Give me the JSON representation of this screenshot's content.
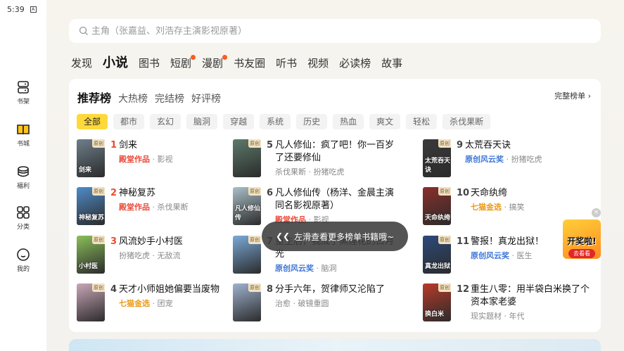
{
  "status": {
    "time": "5:39"
  },
  "sidebar": {
    "items": [
      {
        "label": "书架",
        "icon": "bookshelf-icon"
      },
      {
        "label": "书城",
        "icon": "book-open-icon",
        "active": true
      },
      {
        "label": "福利",
        "icon": "coin-stack-icon"
      },
      {
        "label": "分类",
        "icon": "grid-icon"
      },
      {
        "label": "我的",
        "icon": "smile-icon"
      }
    ]
  },
  "search": {
    "placeholder": "主角（张嘉益、刘浩存主演影视原著）"
  },
  "categories": [
    {
      "label": "发现"
    },
    {
      "label": "小说",
      "active": true
    },
    {
      "label": "图书"
    },
    {
      "label": "短剧",
      "dot": true
    },
    {
      "label": "漫剧",
      "dot": true
    },
    {
      "label": "书友圈"
    },
    {
      "label": "听书"
    },
    {
      "label": "视频"
    },
    {
      "label": "必读榜"
    },
    {
      "label": "故事"
    }
  ],
  "ranking": {
    "tabs": [
      "推荐榜",
      "大热榜",
      "完结榜",
      "好评榜"
    ],
    "full_list": "完整榜单 ›",
    "filters": [
      "全部",
      "都市",
      "玄幻",
      "脑洞",
      "穿越",
      "系统",
      "历史",
      "热血",
      "爽文",
      "轻松",
      "杀伐果断"
    ],
    "books": [
      {
        "rank": "1",
        "title": "剑来",
        "tag": "殿堂作品",
        "tag_color": "red",
        "meta": " · 影视",
        "cover_text": "剑来",
        "cover_color": "#6e7f8a"
      },
      {
        "rank": "2",
        "title": "神秘复苏",
        "tag": "殿堂作品",
        "tag_color": "red",
        "meta": " · 杀伐果断",
        "cover_text": "神秘复苏",
        "cover_color": "#4f8bc9"
      },
      {
        "rank": "3",
        "title": "风流妙手小村医",
        "tag": "",
        "tag_color": "",
        "meta": "扮猪吃虎 · 无敌流",
        "cover_text": "小村医",
        "cover_color": "#8bbf5a"
      },
      {
        "rank": "4",
        "title": "天才小师姐她偏要当废物",
        "tag": "七猫金选",
        "tag_color": "orange",
        "meta": " · 团宠",
        "cover_text": "",
        "cover_color": "#c9a7b8"
      },
      {
        "rank": "5",
        "title": "凡人修仙：疯了吧！你一百岁了还要修仙",
        "tag": "",
        "tag_color": "",
        "meta": "杀伐果断 · 扮猪吃虎",
        "cover_text": "",
        "cover_color": "#5d7a6a"
      },
      {
        "rank": "6",
        "title": "凡人修仙传（杨洋、金晨主演同名影视原著）",
        "tag": "殿堂作品",
        "tag_color": "red",
        "meta": " · 影视",
        "cover_text": "凡人修仙传",
        "cover_color": "#a9c0c8"
      },
      {
        "rank": "7",
        "title": "重生后，我成了黑莲花的白月光",
        "tag": "原创风云奖",
        "tag_color": "blue",
        "meta": " · 脑洞",
        "cover_text": "",
        "cover_color": "#7aa9d8"
      },
      {
        "rank": "8",
        "title": "分手六年，贺律师又沦陷了",
        "tag": "",
        "tag_color": "",
        "meta": "治愈 · 破镜重圆",
        "cover_text": "",
        "cover_color": "#9fb2cf"
      },
      {
        "rank": "9",
        "title": "太荒吞天诀",
        "tag": "原创风云奖",
        "tag_color": "blue",
        "meta": " · 扮猪吃虎",
        "cover_text": "太荒吞天诀",
        "cover_color": "#3a3a3a"
      },
      {
        "rank": "10",
        "title": "天命纨绔",
        "tag": "七猫金选",
        "tag_color": "orange",
        "meta": " · 搞笑",
        "cover_text": "天命纨绔",
        "cover_color": "#8a2f2a"
      },
      {
        "rank": "11",
        "title": "警报！真龙出狱！",
        "tag": "原创风云奖",
        "tag_color": "blue",
        "meta": " · 医生",
        "cover_text": "真龙出狱",
        "cover_color": "#2d4a7a"
      },
      {
        "rank": "12",
        "title": "重生八零：用半袋白米换了个资本家老婆",
        "tag": "",
        "tag_color": "",
        "meta": "现实题材 · 年代",
        "cover_text": "换白米",
        "cover_color": "#b83a2a"
      }
    ],
    "cover_badge": "原创"
  },
  "toast": {
    "icon": "double-chevron-left-icon",
    "text": "左滑查看更多榜单书籍哦~"
  },
  "promo": {
    "text": "开奖啦!",
    "button": "去看看",
    "close": "×"
  }
}
